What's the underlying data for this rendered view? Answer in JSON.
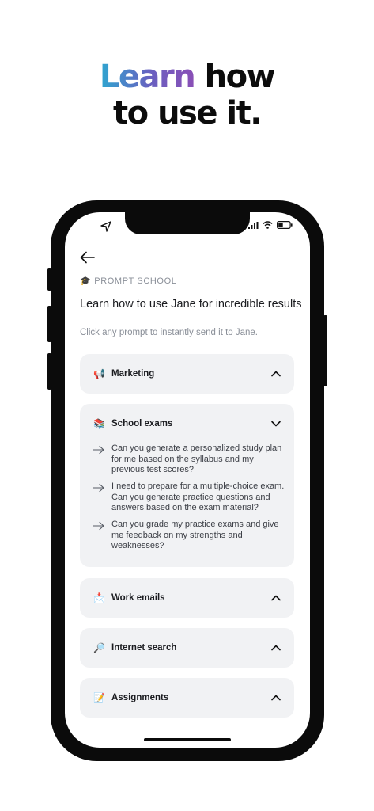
{
  "hero": {
    "line1_highlight": "Learn",
    "line1_rest": " how",
    "line2": "to use it."
  },
  "header": {
    "section_icon": "🎓",
    "section_label": "PROMPT SCHOOL",
    "title": "Learn how to use Jane for incredible results",
    "subtitle": "Click any prompt to instantly send it to Jane."
  },
  "categories": [
    {
      "icon": "📢",
      "label": "Marketing",
      "expanded": false
    },
    {
      "icon": "📚",
      "label": "School exams",
      "expanded": true,
      "prompts": [
        "Can you generate a personalized study plan for me based on the syllabus and my previous test scores?",
        "I need to prepare for a multiple-choice exam. Can you generate practice questions and answers based on the exam material?",
        "Can you grade my practice exams and give me feedback on my strengths and weaknesses?"
      ]
    },
    {
      "icon": "📩",
      "label": "Work emails",
      "expanded": false
    },
    {
      "icon": "🔎",
      "label": "Internet search",
      "expanded": false
    },
    {
      "icon": "📝",
      "label": "Assignments",
      "expanded": false
    }
  ],
  "icons": {
    "back": "arrow-left-icon",
    "location": "location-arrow-icon",
    "signal": "cellular-signal-icon",
    "wifi": "wifi-icon",
    "battery": "battery-icon",
    "collapse": "chevron-up-icon",
    "expand": "chevron-down-icon",
    "prompt": "arrow-right-icon"
  }
}
